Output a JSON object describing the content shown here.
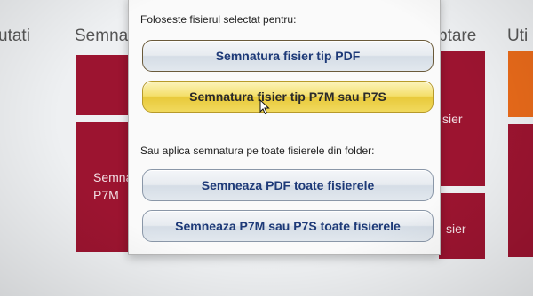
{
  "background": {
    "headings": {
      "utati": "utati",
      "semnare": "Semnare",
      "ptare": "ptare",
      "uti": "Uti"
    },
    "tiles": {
      "left_label": "Semna\nP7M",
      "right_top_label": "sier",
      "right_bottom_label": "sier"
    },
    "colors": {
      "tile_crimson": "#9c1430",
      "tile_orange": "#e86a1a",
      "page_bg": "#eef0f2"
    }
  },
  "dialog": {
    "section1_label": "Foloseste fisierul selectat pentru:",
    "btn_sign_pdf": "Semnatura fisier tip PDF",
    "btn_sign_p7m": "Semnatura fisier tip P7M sau P7S",
    "section2_label": "Sau aplica semnatura pe toate fisierele din folder:",
    "btn_sign_all_pdf": "Semneaza PDF toate fisierele",
    "btn_sign_all_p7m": "Semneaza P7M sau P7S toate fisierele"
  },
  "colors": {
    "button_text": "#1e3a78",
    "hover_gradient_top": "#fcf4bd",
    "hover_gradient_bottom": "#e8c93a"
  },
  "icons": {
    "cursor": "mouse-pointer-icon"
  }
}
